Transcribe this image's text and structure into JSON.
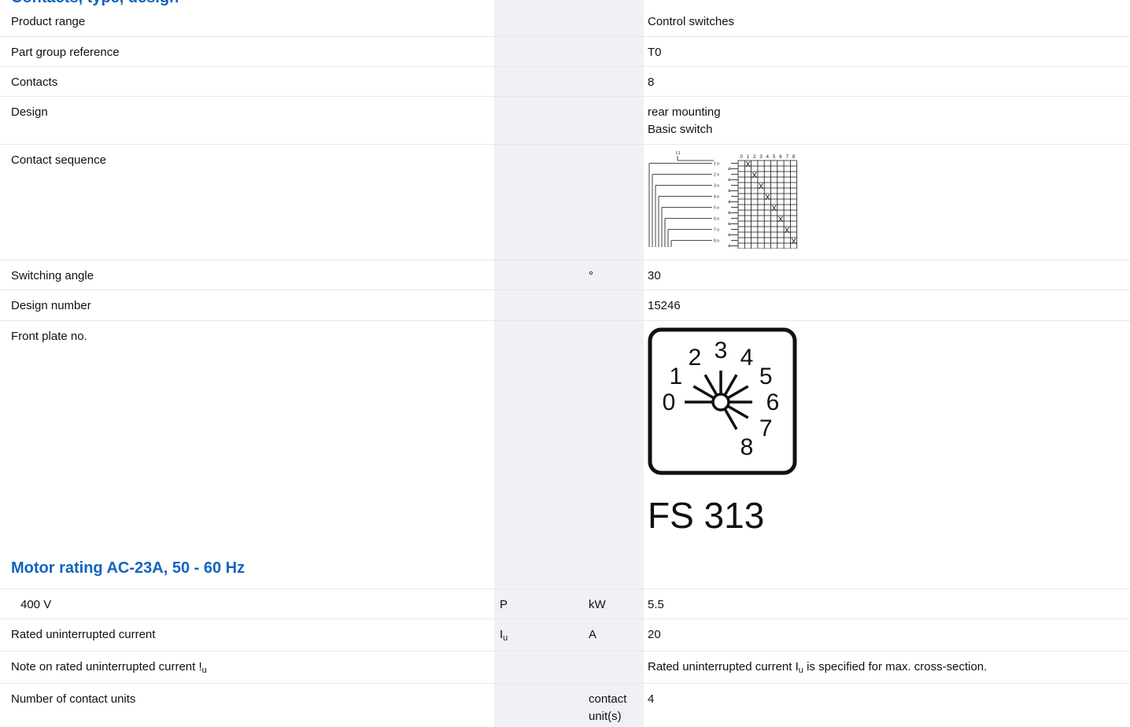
{
  "section_header_partial": "Contacts, type, design",
  "rows": {
    "product_range": {
      "label": "Product range",
      "value": "Control switches"
    },
    "part_group": {
      "label": "Part group reference",
      "value": "T0"
    },
    "contacts": {
      "label": "Contacts",
      "value": "8"
    },
    "design": {
      "label": "Design",
      "value_line1": "rear mounting",
      "value_line2": "Basic switch"
    },
    "contact_sequence": {
      "label": "Contact sequence",
      "diagram": {
        "input_label": "L1",
        "columns": [
          "0",
          "1",
          "2",
          "3",
          "4",
          "5",
          "6",
          "7",
          "8"
        ],
        "terminals": [
          "1",
          "2",
          "3",
          "4",
          "5",
          "6",
          "7",
          "8"
        ],
        "mark": "X"
      }
    },
    "switching_angle": {
      "label": "Switching angle",
      "unit": "°",
      "value": "30"
    },
    "design_number": {
      "label": "Design number",
      "value": "15246"
    },
    "front_plate": {
      "label": "Front plate no.",
      "positions": [
        "0",
        "1",
        "2",
        "3",
        "4",
        "5",
        "6",
        "7",
        "8"
      ],
      "caption": "FS 313"
    }
  },
  "motor_section": {
    "title": "Motor rating AC-23A, 50 - 60 Hz",
    "row_400v": {
      "label": "400 V",
      "symbol": "P",
      "unit": "kW",
      "value": "5.5"
    }
  },
  "rated_current": {
    "label": "Rated uninterrupted current",
    "symbol": "I",
    "symbol_sub": "u",
    "unit": "A",
    "value": "20"
  },
  "note_current": {
    "label_pre": "Note on rated uninterrupted current !",
    "label_sub": "u",
    "value_pre": "Rated uninterrupted current I",
    "value_sub": "u",
    "value_post": " is specified for max. cross-section."
  },
  "contact_units": {
    "label": "Number of contact units",
    "unit_line1": "contact",
    "unit_line2": "unit(s)",
    "value": "4"
  },
  "colors": {
    "accent": "#1164c0",
    "band": "#eff1f5",
    "divider": "#e6e8ec"
  }
}
